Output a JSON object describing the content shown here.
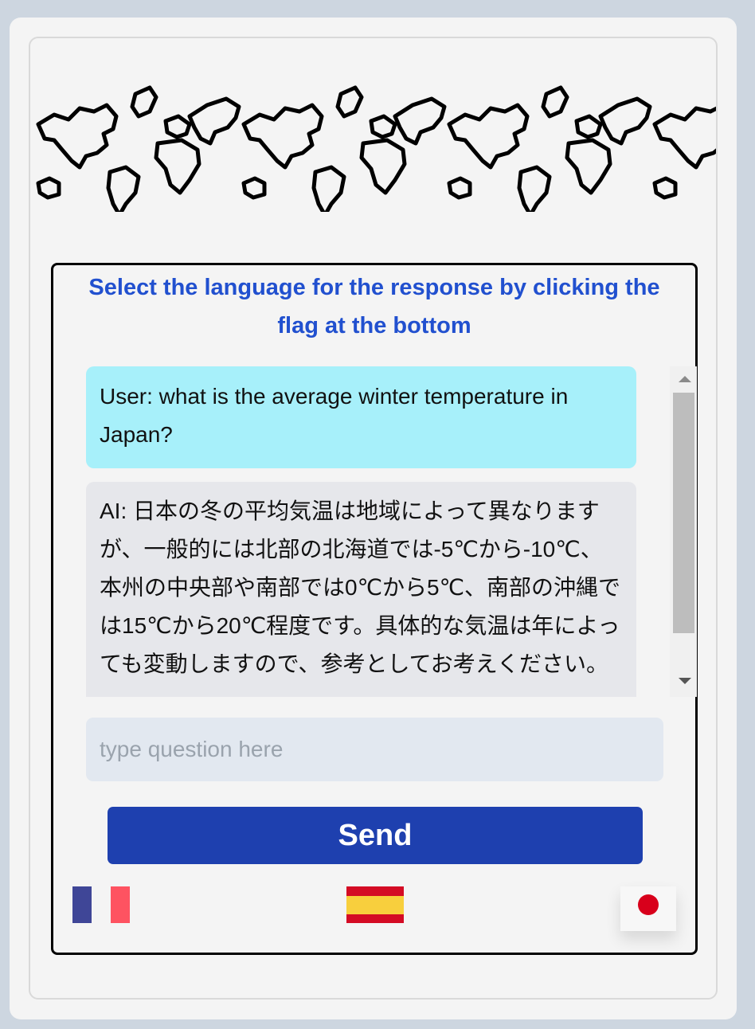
{
  "banner": {
    "icon": "world-map-icon"
  },
  "instructions": "Select the language for the response by clicking the flag at the bottom",
  "chat": {
    "messages": [
      {
        "role": "user",
        "text": "User: what is the average winter temperature in Japan?"
      },
      {
        "role": "ai",
        "text": "AI: 日本の冬の平均気温は地域によって異なりますが、一般的には北部の北海道では-5℃から-10℃、本州の中央部や南部では0℃から5℃、南部の沖縄では15℃から20℃程度です。具体的な気温は年によっても変動しますので、参考としてお考えください。"
      }
    ]
  },
  "input": {
    "placeholder": "type question here",
    "value": ""
  },
  "send_label": "Send",
  "flags": [
    {
      "language": "French",
      "icon": "flag-france-icon"
    },
    {
      "language": "Spanish",
      "icon": "flag-spain-icon"
    },
    {
      "language": "Japanese",
      "icon": "flag-japan-icon",
      "selected": true
    }
  ],
  "colors": {
    "accent": "#2150cf",
    "button": "#1e40af",
    "user_bubble": "#a7f0fa",
    "ai_bubble": "#e6e7eb",
    "input_bg": "#e2e8f0",
    "fr_blue": "#3f4697",
    "fr_white": "#f4f4f4",
    "fr_red": "#fe5361",
    "es_red": "#d40b24",
    "es_yellow": "#f8cf3d",
    "jp_red": "#d8001b"
  }
}
